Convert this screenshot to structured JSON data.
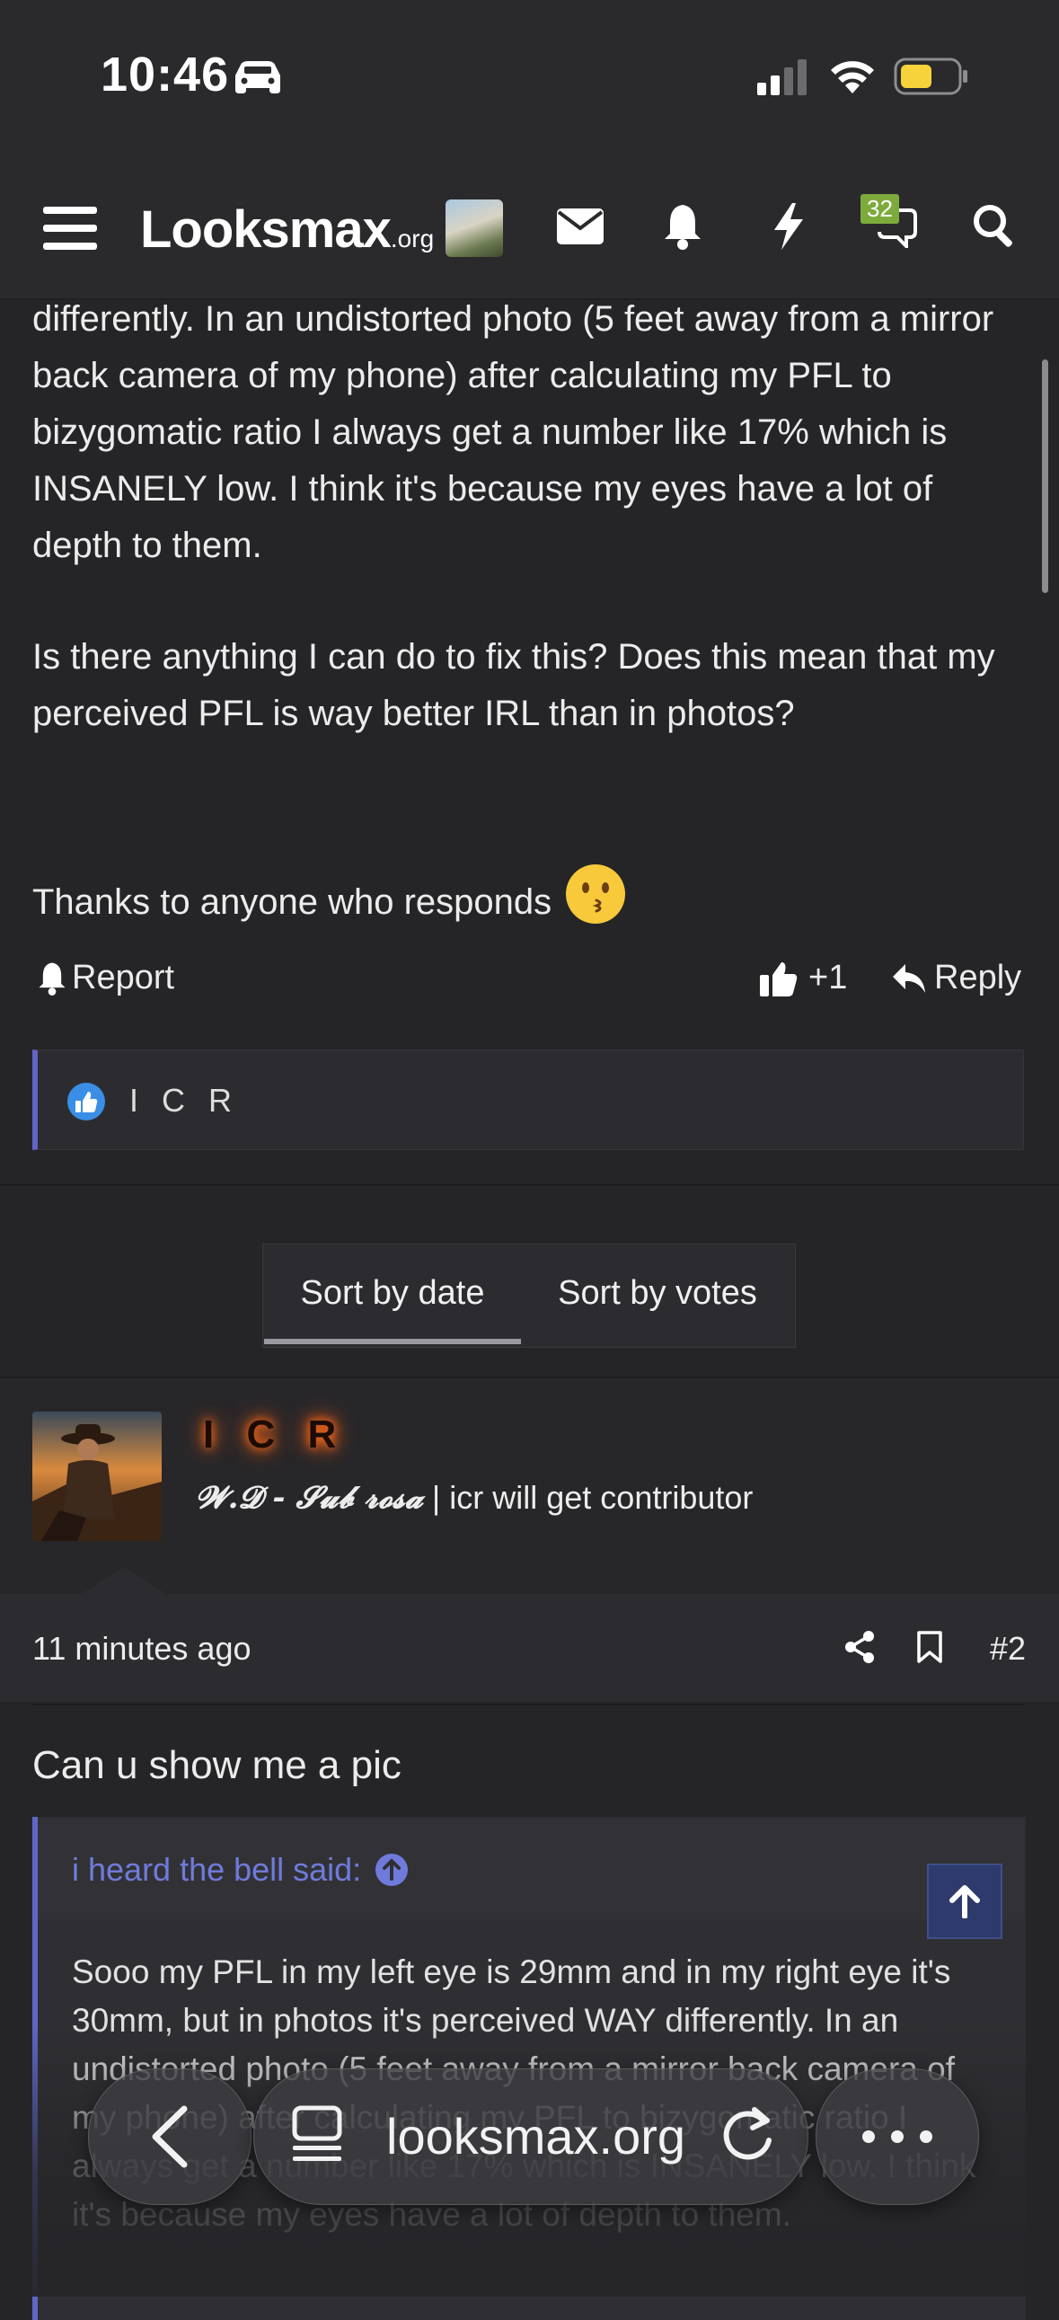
{
  "status_bar": {
    "time": "10:46"
  },
  "nav": {
    "logo": "Lᴏᴏksmax",
    "logo_suffix": ".org",
    "chat_badge": "32"
  },
  "post1": {
    "paragraph1": "differently. In an undistorted photo (5 feet away from a mirror back camera of my phone) after calculating my PFL to bizygomatic ratio I always get a number like 17% which is INSANELY low. I think it's because my eyes have a lot of depth to them.",
    "paragraph2": "Is there anything I can do to fix this? Does this mean that my perceived PFL is way better IRL than in photos?",
    "paragraph3": "Thanks to anyone who responds",
    "report_label": "Report",
    "like_count": "+1",
    "reply_label": "Reply",
    "reaction_user": "I C R"
  },
  "sort": {
    "by_date": "Sort by date",
    "by_votes": "Sort by votes"
  },
  "post2": {
    "author": "I C R",
    "title_fancy": "𝓦.𝓓 - 𝓢𝓾𝓫 𝓻𝓸𝓼𝓪",
    "title_rest": "| icr will get contributor",
    "time": "11 minutes ago",
    "number": "#2",
    "text": "Can u show me a pic",
    "quote_author": "i heard the bell said:",
    "quote_text": "Sooo my PFL in my left eye is 29mm and in my right eye it's 30mm, but in photos it's perceived WAY differently. In an undistorted photo (5 feet away from a mirror back camera of my phone) after calculating my PFL to bizygomatic ratio I always get a number like 17% which is INSANELY low. I think it's because my eyes have a lot of depth to them."
  },
  "browser": {
    "url": "looksmax.org"
  },
  "colors": {
    "accent": "#5f66c7",
    "name_glow": "#ff6a1a",
    "badge": "#7dab3b",
    "background": "#252528"
  }
}
